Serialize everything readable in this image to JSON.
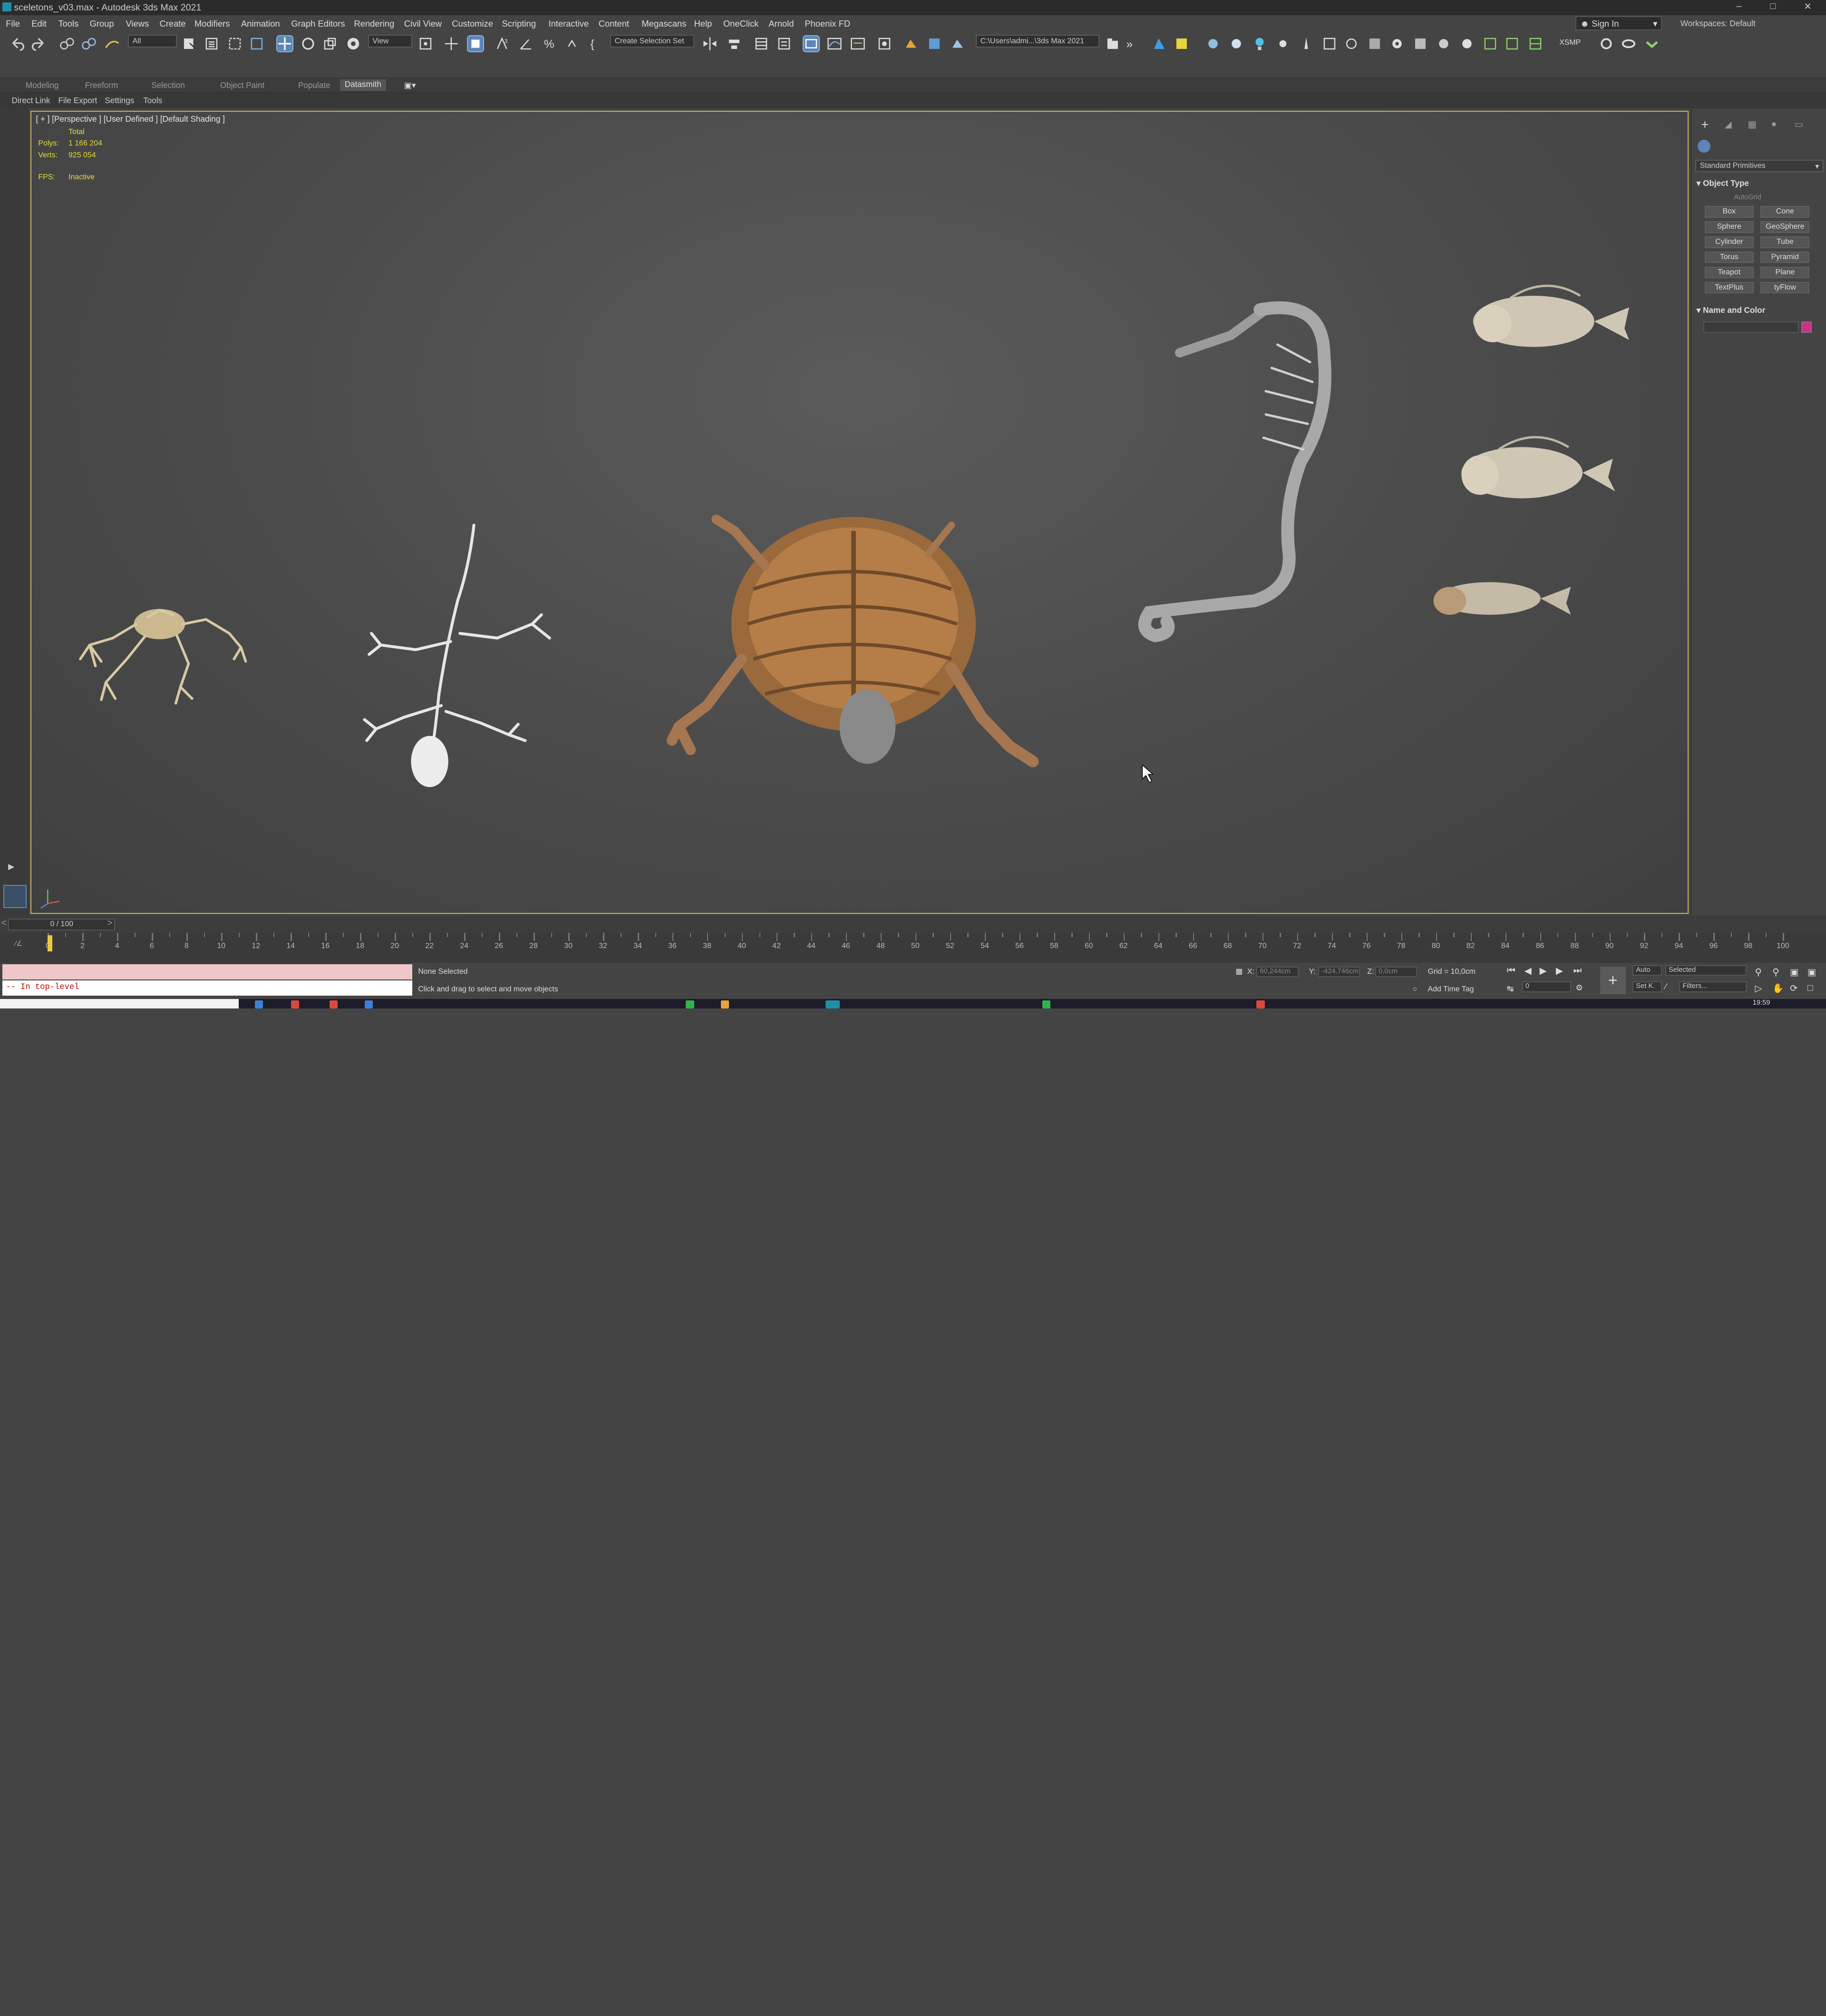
{
  "window": {
    "title": "sceletons_v03.max - Autodesk 3ds Max 2021",
    "controls": [
      "–",
      "□",
      "✕"
    ]
  },
  "menu": {
    "items": [
      "File",
      "Edit",
      "Tools",
      "Group",
      "Views",
      "Create",
      "Modifiers",
      "Animation",
      "Graph Editors",
      "Rendering",
      "Civil View",
      "Customize",
      "Scripting",
      "Interactive",
      "Content",
      "Megascans",
      "Help",
      "OneClick",
      "Arnold",
      "Phoenix FD"
    ],
    "sign_in": "Sign In",
    "workspaces": "Workspaces: Default"
  },
  "toolbar": {
    "selection_filter": "All",
    "reference_coord": "View",
    "selection_set": "Create Selection Set",
    "project_path": "C:\\Users\\admi...\\3ds Max 2021",
    "xsmp": "XSMP"
  },
  "ribbon": {
    "tabs": [
      "Modeling",
      "Freeform",
      "Selection",
      "Object Paint",
      "Populate",
      "Datasmith"
    ],
    "active": "Datasmith",
    "subtabs": [
      "Direct Link",
      "File Export",
      "Settings",
      "Tools"
    ]
  },
  "viewport": {
    "label": "[ + ] [Perspective ]  [User Defined ]  [Default Shading ]",
    "stats_total": "Total",
    "polys_label": "Polys:",
    "polys_value": "1 166 204",
    "verts_label": "Verts:",
    "verts_value": "925 054",
    "fps_label": "FPS:",
    "fps_value": "Inactive",
    "objects": [
      "frog-skeleton",
      "lizard-skeleton",
      "turtle-skeleton",
      "seahorse-skeleton",
      "fish-skeleton-top",
      "fish-skeleton-middle",
      "fish-skeleton-bottom"
    ]
  },
  "command_panel": {
    "category": "Standard Primitives",
    "object_type": "Object Type",
    "autogrid": "AutoGrid",
    "buttons": [
      "Box",
      "Cone",
      "Sphere",
      "GeoSphere",
      "Cylinder",
      "Tube",
      "Torus",
      "Pyramid",
      "Teapot",
      "Plane",
      "TextPlus",
      "tyFlow"
    ],
    "name_and_color": "Name and Color",
    "color_swatch": "#d62c8e"
  },
  "timeline": {
    "frame_display": "0 / 100",
    "ticks": [
      "0",
      "2",
      "4",
      "6",
      "8",
      "10",
      "12",
      "14",
      "16",
      "18",
      "20",
      "22",
      "24",
      "26",
      "28",
      "30",
      "32",
      "34",
      "36",
      "38",
      "40",
      "42",
      "44",
      "46",
      "48",
      "50",
      "52",
      "54",
      "56",
      "58",
      "60",
      "62",
      "64",
      "66",
      "68",
      "70",
      "72",
      "74",
      "76",
      "78",
      "80",
      "82",
      "84",
      "86",
      "88",
      "90",
      "92",
      "94",
      "96",
      "98",
      "100"
    ]
  },
  "status": {
    "listener_output": "-- In top-level",
    "selection": "None Selected",
    "prompt": "Click and drag to select and move objects",
    "x_label": "X:",
    "x_value": "60,244cm",
    "y_label": "Y:",
    "y_value": "-424,746cm",
    "z_label": "Z:",
    "z_value": "0,0cm",
    "grid": "Grid = 10,0cm",
    "add_time_tag": "Add Time Tag",
    "auto": "Auto",
    "set_key": "Set K.",
    "key_filter": "Selected",
    "filters": "Filters...",
    "current_frame": "0"
  },
  "taskbar": {
    "time": "19:59"
  },
  "colors": {
    "accent": "#5c86b8",
    "viewport_border": "#c9b458",
    "stats": "#e8dc3c"
  }
}
